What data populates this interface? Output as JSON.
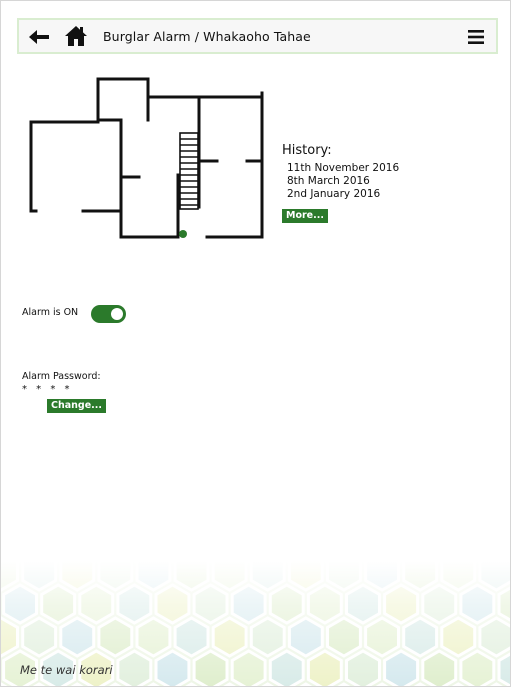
{
  "header": {
    "title": "Burglar Alarm / Whakaoho Tahae",
    "icons": [
      "arrow-left-icon",
      "home-icon",
      "hamburger-menu-icon"
    ]
  },
  "history": {
    "title": "History:",
    "entries": [
      "11th November 2016",
      "8th March 2016",
      "2nd January 2016"
    ],
    "more_label": "More..."
  },
  "alarm": {
    "status_label": "Alarm is ON",
    "enabled": true
  },
  "password": {
    "label": "Alarm Password:",
    "masked_value": "* * * *",
    "change_label": "Change..."
  },
  "footer": {
    "text": "Me te wai korari"
  },
  "colors": {
    "accent": "#2b7a2b",
    "header_border": "#d9edd0",
    "header_bg": "#f7f7f7"
  }
}
